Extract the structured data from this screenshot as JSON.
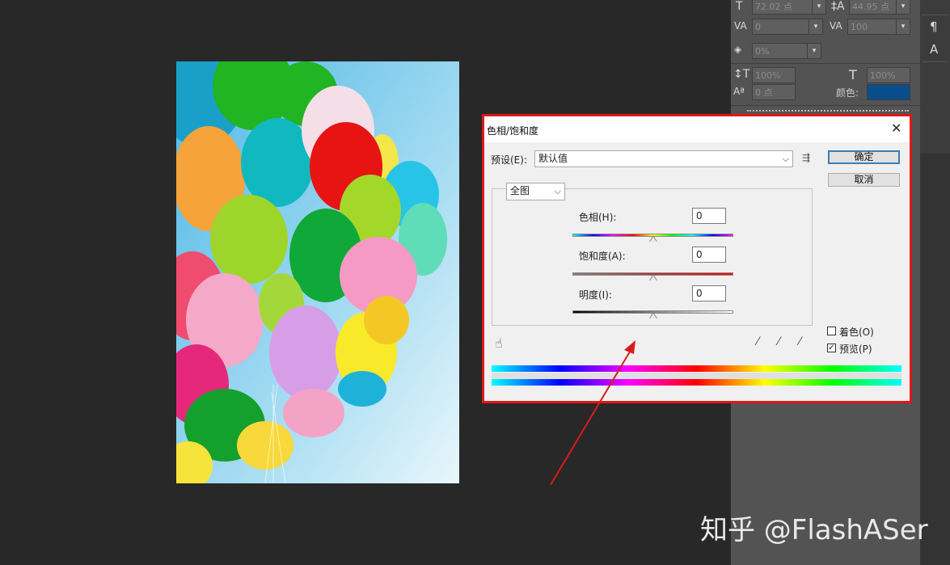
{
  "char_panel": {
    "font_size": "72.02 点",
    "leading": "44.95 点",
    "kerning": "0",
    "tracking": "100",
    "tsume": "0%",
    "vscale": "100%",
    "hscale": "100%",
    "baseline": "0 点",
    "color_label": "颜色:",
    "color_value": "#0a4d8c",
    "icons": {
      "font_size": "T",
      "leading": "‡A",
      "kerning": "VA",
      "tracking": "VA",
      "tsume": "◈",
      "vscale": "↕T",
      "hscale": "T",
      "baseline": "Aª",
      "side_para": "¶",
      "side_char": "A"
    }
  },
  "dialog": {
    "title": "色相/饱和度",
    "close": "✕",
    "preset_label": "预设(E):",
    "preset_value": "默认值",
    "preset_menu_icon": "⇶",
    "ok_label": "确定",
    "cancel_label": "取消",
    "channel_value": "全图",
    "hue_label": "色相(H):",
    "hue_value": "0",
    "saturation_label": "饱和度(A):",
    "saturation_value": "0",
    "lightness_label": "明度(I):",
    "lightness_value": "0",
    "colorize_label": "着色(O)",
    "colorize_checked": false,
    "preview_label": "预览(P)",
    "preview_checked": true,
    "check_mark": "✓",
    "hand_icon": "☝",
    "eyedropper_icons": [
      "⁄",
      "⁄",
      "⁄"
    ]
  },
  "watermark": "知乎 @FlashASer",
  "colors": {
    "workspace": "#282828",
    "panel": "#535353",
    "highlight_outline": "#e01818",
    "annotation_arrow": "#d81c1c"
  }
}
